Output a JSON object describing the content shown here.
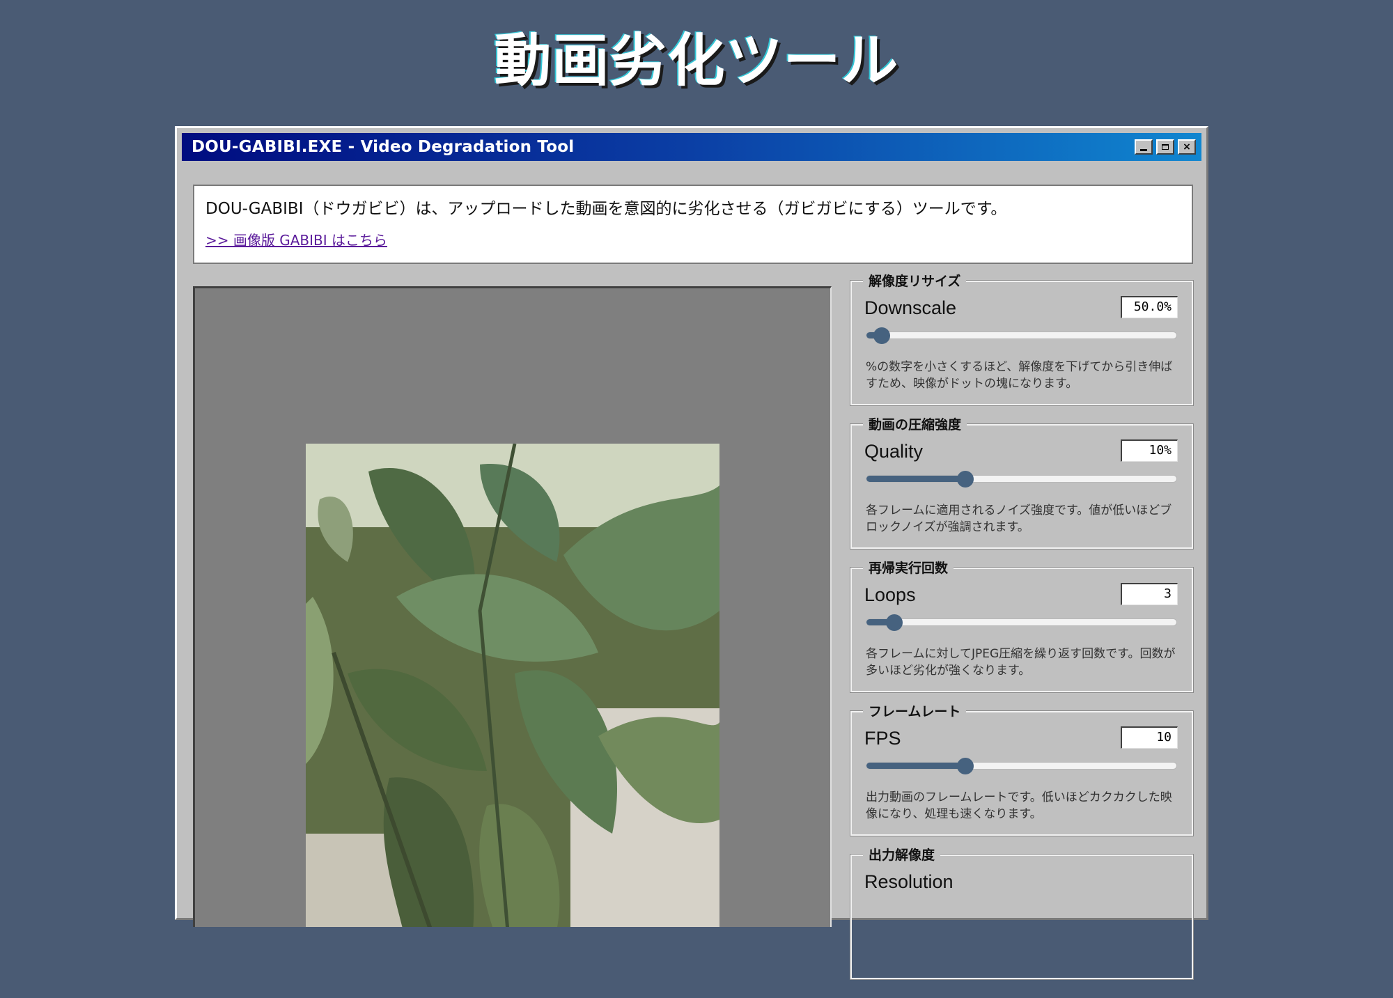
{
  "page": {
    "title": "動画劣化ツール"
  },
  "window": {
    "title": "DOU-GABIBI.EXE - Video Degradation Tool",
    "buttons": {
      "minimize": "_",
      "maximize": "□",
      "close": "×"
    }
  },
  "intro": {
    "text": "DOU-GABIBI（ドウガビビ）は、アップロードした動画を意図的に劣化させる（ガビガビにする）ツールです。",
    "link": ">> 画像版 GABIBI はこちら"
  },
  "controls": [
    {
      "group": "解像度リサイズ",
      "label": "Downscale",
      "value": "50.0%",
      "level": 0.05,
      "desc": "%の数字を小さくするほど、解像度を下げてから引き伸ばすため、映像がドットの塊になります。"
    },
    {
      "group": "動画の圧縮強度",
      "label": "Quality",
      "value": "10%",
      "level": 0.32,
      "desc": "各フレームに適用されるノイズ強度です。値が低いほどブロックノイズが強調されます。"
    },
    {
      "group": "再帰実行回数",
      "label": "Loops",
      "value": "3",
      "level": 0.09,
      "desc": "各フレームに対してJPEG圧縮を繰り返す回数です。回数が多いほど劣化が強くなります。"
    },
    {
      "group": "フレームレート",
      "label": "FPS",
      "value": "10",
      "level": 0.32,
      "desc": "出力動画のフレームレートです。低いほどカクカクした映像になり、処理も速くなります。"
    },
    {
      "group": "出力解像度",
      "label": "Resolution"
    }
  ],
  "colors": {
    "background": "#4a5b74",
    "accent": "#46627f",
    "titlebar_start": "#000c80",
    "titlebar_end": "#1086d0"
  }
}
